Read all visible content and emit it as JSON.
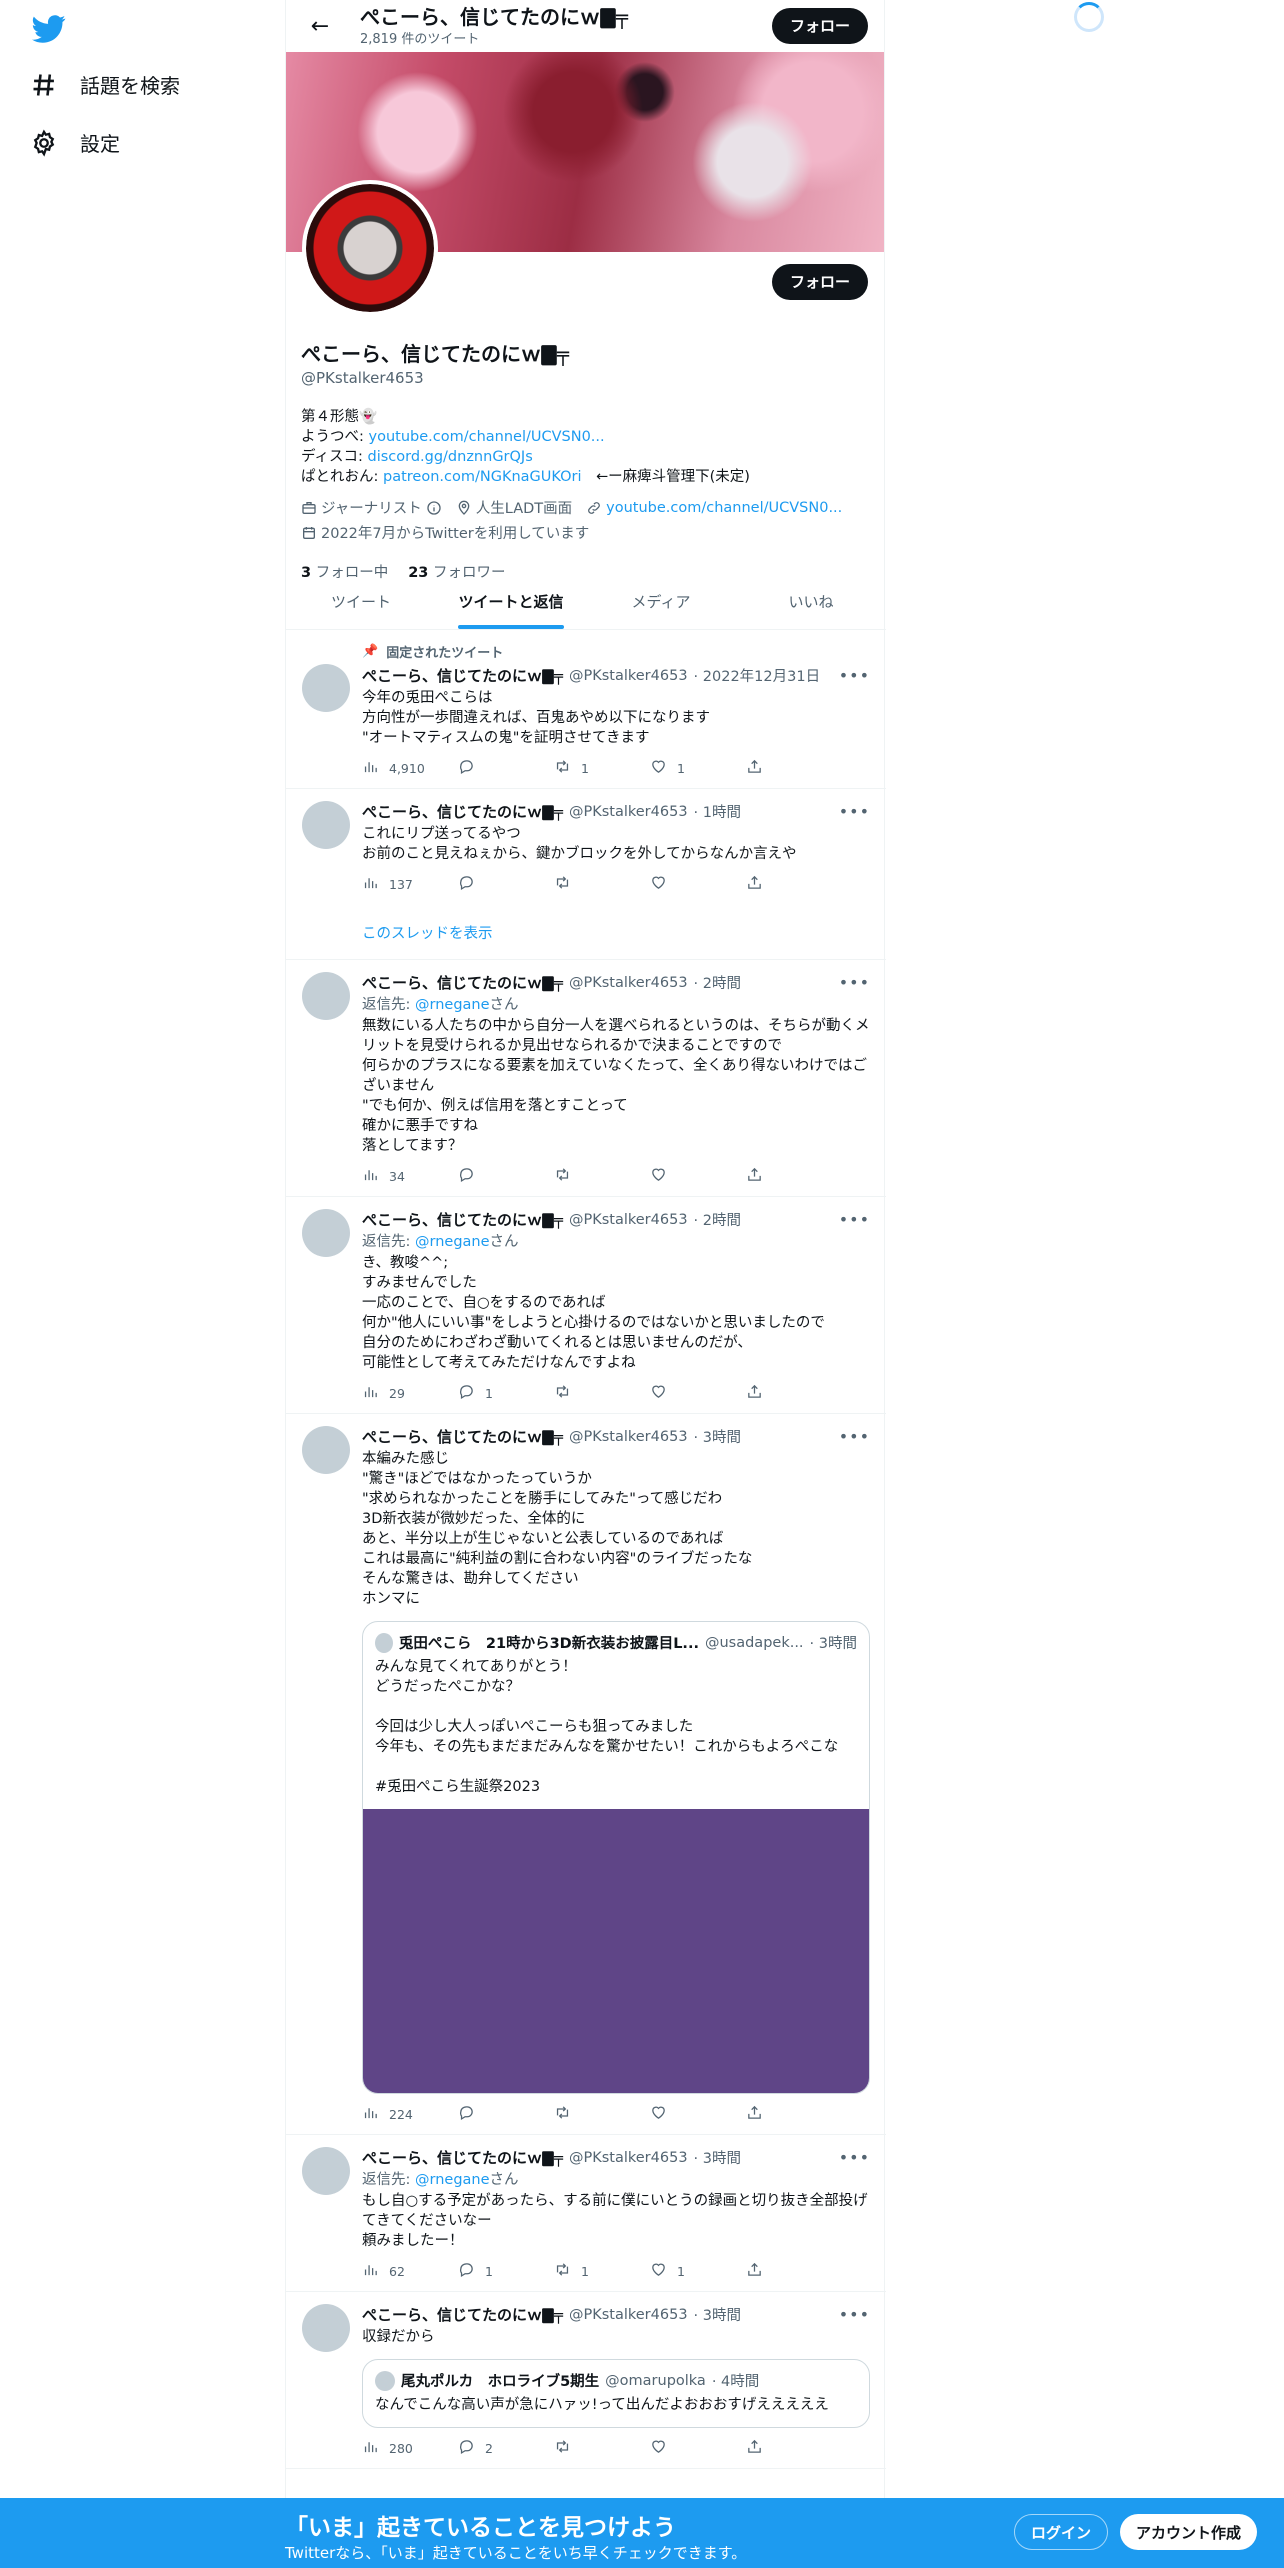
{
  "nav": {
    "explore_label": "話題を検索",
    "settings_label": "設定"
  },
  "header": {
    "title": "ぺこーら、信じてたのにｗ🀫╤",
    "tweet_count": "2,819 件のツイート",
    "follow_label": "フォロー"
  },
  "profile": {
    "name": "ぺこーら、信じてたのにｗ🀫╤",
    "handle": "@PKstalker4653",
    "follow_label": "フォロー",
    "bio_line1": "第４形態👻",
    "bio_line2_prefix": "ようつべ: ",
    "bio_line2_link": "youtube.com/channel/UCVSN0...",
    "bio_line3_prefix": "ディスコ: ",
    "bio_line3_link": "discord.gg/dnznnGrQJs",
    "bio_line4_prefix": "ぱとれおん: ",
    "bio_line4_link": "patreon.com/NGKnaGUKOri",
    "bio_line4_suffix": "←ー麻痺斗管理下(未定)",
    "category": "ジャーナリスト",
    "location": "人生LADT画面",
    "website": "youtube.com/channel/UCVSN0...",
    "joined": "2022年7月からTwitterを利用しています",
    "following_count": "3",
    "following_label": "フォロー中",
    "followers_count": "23",
    "followers_label": "フォロワー"
  },
  "tabs": [
    "ツイート",
    "ツイートと返信",
    "メディア",
    "いいね"
  ],
  "tweets": [
    {
      "pinned_label": "固定されたツイート",
      "name": "ぺこーら、信じてたのにｗ🀫╤",
      "handle": "@PKstalker4653",
      "time": "· 2022年12月31日",
      "text": "今年の兎田ぺこらは\n方向性が一歩間違えれば、百鬼あやめ以下になります\n\"オートマティスムの鬼\"を証明させてきます",
      "views": "4,910",
      "replies": "",
      "retweets": "1",
      "likes": "1"
    },
    {
      "name": "ぺこーら、信じてたのにｗ🀫╤",
      "handle": "@PKstalker4653",
      "time": "· 1時間",
      "text": "これにリプ送ってるやつ\nお前のこと見えねぇから、鍵かブロックを外してからなんか言えや",
      "views": "137",
      "replies": "",
      "retweets": "",
      "likes": "",
      "show_thread": "このスレッドを表示"
    },
    {
      "name": "ぺこーら、信じてたのにｗ🀫╤",
      "handle": "@PKstalker4653",
      "time": "· 2時間",
      "reply_prefix": "返信先: ",
      "reply_handle": "@rnegane",
      "reply_suffix": "さん",
      "text": "無数にいる人たちの中から自分一人を選べられるというのは、そちらが動くメリットを見受けられるか見出せなられるかで決まることですので\n何らかのプラスになる要素を加えていなくたって、全くあり得ないわけではございません\n\"でも何か、例えば信用を落とすことって\n確かに悪手ですね\n落としてます？",
      "views": "34",
      "replies": "",
      "retweets": "",
      "likes": ""
    },
    {
      "name": "ぺこーら、信じてたのにｗ🀫╤",
      "handle": "@PKstalker4653",
      "time": "· 2時間",
      "reply_prefix": "返信先: ",
      "reply_handle": "@rnegane",
      "reply_suffix": "さん",
      "text": "き、教唆^^;\nすみませんでした\n一応のことで、自○をするのであれば\n何か\"他人にいい事\"をしようと心掛けるのではないかと思いましたので\n自分のためにわざわざ動いてくれるとは思いませんのだが、\n可能性として考えてみただけなんですよね",
      "views": "29",
      "replies": "1",
      "retweets": "",
      "likes": ""
    },
    {
      "name": "ぺこーら、信じてたのにｗ🀫╤",
      "handle": "@PKstalker4653",
      "time": "· 3時間",
      "text": "本編みた感じ\n\"驚き\"ほどではなかったっていうか\n\"求められなかったことを勝手にしてみた\"って感じだわ\n3D新衣装が微妙だった、全体的に\nあと、半分以上が生じゃないと公表しているのであれば\nこれは最高に\"純利益の割に合わない内容\"のライブだったな\nそんな驚きは、勘弁してください\nホンマに",
      "quote": {
        "name": "兎田ぺこら　21時から3D新衣装お披露目L...",
        "handle": "@usadapek...",
        "time": "· 3時間",
        "text": "みんな見てくれてありがとう！\nどうだったぺこかな？\n\n今回は少し大人っぽいぺこーらも狙ってみました\n今年も、その先もまだまだみんなを驚かせたい！これからもよろぺこな\n\n#兎田ぺこら生誕祭2023"
      },
      "views": "224",
      "replies": "",
      "retweets": "",
      "likes": ""
    },
    {
      "name": "ぺこーら、信じてたのにｗ🀫╤",
      "handle": "@PKstalker4653",
      "time": "· 3時間",
      "reply_prefix": "返信先: ",
      "reply_handle": "@rnegane",
      "reply_suffix": "さん",
      "text": "もし自○する予定があったら、する前に僕にいとうの録画と切り抜き全部投げてきてくださいなー\n頼みましたー！",
      "views": "62",
      "replies": "1",
      "retweets": "1",
      "likes": "1"
    },
    {
      "name": "ぺこーら、信じてたのにｗ🀫╤",
      "handle": "@PKstalker4653",
      "time": "· 3時間",
      "text": "収録だから",
      "quote": {
        "name": "尾丸ポルカ　ホロライブ5期生",
        "handle": "@omarupolka",
        "time": "· 4時間",
        "text": "なんでこんな高い声が急にハァッ!って出んだよおおおすげえええええ"
      },
      "views": "280",
      "replies": "2",
      "retweets": "",
      "likes": ""
    }
  ],
  "bottom_bar": {
    "title": "「いま」起きていることを見つけよう",
    "subtitle": "Twitterなら、「いま」起きていることをいち早くチェックできます。",
    "login_label": "ログイン",
    "signup_label": "アカウント作成"
  },
  "colors": {
    "accent": "#1d9bf0",
    "text": "#0f1419",
    "muted": "#536471"
  }
}
